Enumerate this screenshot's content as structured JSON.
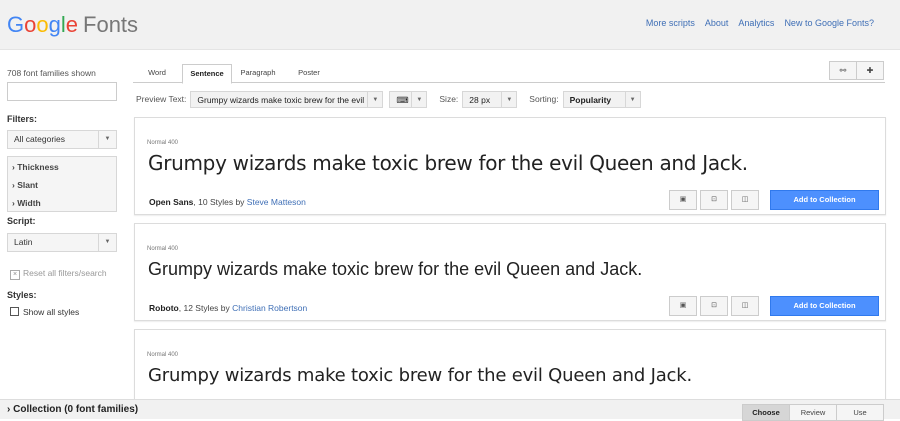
{
  "header": {
    "logo": {
      "g": "G",
      "o1": "o",
      "o2": "o",
      "g2": "g",
      "l": "l",
      "e": "e",
      "fonts": "Fonts"
    },
    "links": [
      "More scripts",
      "About",
      "Analytics",
      "New to Google Fonts?"
    ]
  },
  "sidebar": {
    "shown": "708 font families shown",
    "filters_label": "Filters:",
    "category": "All categories",
    "filters": [
      "Thickness",
      "Slant",
      "Width"
    ],
    "script_label": "Script:",
    "script": "Latin",
    "reset": "Reset all filters/search",
    "styles_label": "Styles:",
    "show_all": "Show all styles"
  },
  "tabs": [
    "Word",
    "Sentence",
    "Paragraph",
    "Poster"
  ],
  "toolbar": {
    "preview_label": "Preview Text:",
    "preview_value": "Grumpy wizards make toxic brew for the evil",
    "size_label": "Size:",
    "size_value": "28 px",
    "sorting_label": "Sorting:",
    "sorting_value": "Popularity"
  },
  "cards": [
    {
      "style": "Normal 400",
      "sample": "Grumpy wizards make toxic brew for the evil Queen and Jack.",
      "family": "Open Sans",
      "styles": ", 10 Styles by ",
      "author": "Steve Matteson",
      "button": "Add to Collection"
    },
    {
      "style": "Normal 400",
      "sample": "Grumpy wizards make toxic brew for the evil Queen and Jack.",
      "family": "Roboto",
      "styles": ", 12 Styles by ",
      "author": "Christian Robertson",
      "button": "Add to Collection"
    },
    {
      "style": "Normal 400",
      "sample": "Grumpy wizards make toxic brew for the evil Queen and Jack."
    }
  ],
  "footer": {
    "collection": "Collection (0 font families)",
    "tabs": [
      "Choose",
      "Review",
      "Use"
    ]
  }
}
